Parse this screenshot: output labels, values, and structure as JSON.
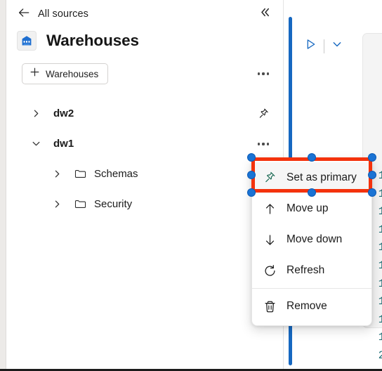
{
  "topbar": {
    "back_label": "All sources",
    "back_icon": "arrow-left-icon",
    "collapse_icon": "double-chevron-left-icon"
  },
  "header": {
    "title": "Warehouses",
    "icon": "warehouse-icon"
  },
  "actions": {
    "new_label": "Warehouses",
    "new_icon": "plus-icon",
    "more_icon": "ellipsis-icon"
  },
  "tree": {
    "items": [
      {
        "label": "dw2",
        "level": 1,
        "expanded": false,
        "twisty": "chevron-right-icon",
        "trailing": "pin-icon"
      },
      {
        "label": "dw1",
        "level": 1,
        "expanded": true,
        "twisty": "chevron-down-icon",
        "trailing": "ellipsis-icon"
      },
      {
        "label": "Schemas",
        "level": 2,
        "expanded": false,
        "twisty": "chevron-right-icon",
        "icon": "folder-icon",
        "trailing": ""
      },
      {
        "label": "Security",
        "level": 2,
        "expanded": false,
        "twisty": "chevron-right-icon",
        "icon": "folder-icon",
        "trailing": ""
      }
    ]
  },
  "context_menu": {
    "items": [
      {
        "label": "Set as primary",
        "icon": "pin-icon",
        "highlighted": true
      },
      {
        "label": "Move up",
        "icon": "arrow-up-icon",
        "highlighted": false
      },
      {
        "label": "Move down",
        "icon": "arrow-down-icon",
        "highlighted": false
      },
      {
        "label": "Refresh",
        "icon": "refresh-icon",
        "highlighted": false
      },
      {
        "label": "Remove",
        "icon": "trash-icon",
        "highlighted": false
      }
    ],
    "separator_before_index": 4
  },
  "annotation": {
    "target_label": "Set as primary",
    "border_color": "#f4320c",
    "handle_color": "#1a73d4",
    "handle_count": 8
  },
  "editor": {
    "run_icon": "play-icon",
    "run_dropdown_icon": "chevron-down-icon",
    "scrollbar_color": "#1668c1",
    "line_numbers": [
      "1",
      "1",
      "1",
      "1",
      "1",
      "1",
      "1",
      "1",
      "1",
      "1",
      "2"
    ]
  },
  "colors": {
    "accent_blue": "#1668c1",
    "annotation_red": "#f4320c",
    "handle_blue": "#1a73d4",
    "line_number_teal": "#1c6b72"
  }
}
